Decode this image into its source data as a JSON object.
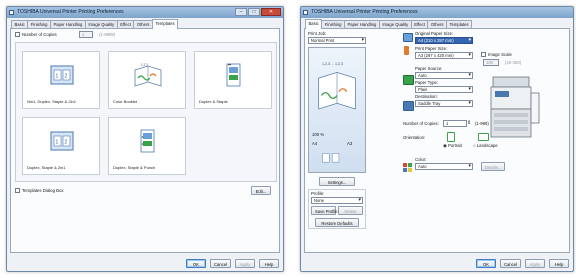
{
  "left_window": {
    "title": "TOSHIBA Universal Printer Printing Preferences",
    "tabs": [
      "Basic",
      "Finishing",
      "Paper Handling",
      "Image Quality",
      "Effect",
      "Others",
      "Templates"
    ],
    "active_tab": "Templates",
    "number_of_copies_label": "Number of Copies",
    "copies_value": "1",
    "copies_range": "(1-9999)",
    "templates": [
      {
        "caption": "Nin1, Duplex, Staple & 2in1"
      },
      {
        "caption": "Color Booklet"
      },
      {
        "caption": "Duplex & Staple"
      },
      {
        "caption": "Duplex, Staple & 2in1"
      },
      {
        "caption": "Duplex, Staple & Punch"
      }
    ],
    "templates_dialog_label": "Templates Dialog Box",
    "edit_button": "Edit...",
    "buttons": {
      "ok": "OK",
      "cancel": "Cancel",
      "apply": "Apply",
      "help": "Help"
    }
  },
  "right_window": {
    "title": "TOSHIBA Universal Printer Printing Preferences",
    "tabs": [
      "Basic",
      "Finishing",
      "Paper Handling",
      "Image Quality",
      "Effect",
      "Others",
      "Templates"
    ],
    "active_tab": "Basic",
    "print_job_label": "Print Job:",
    "print_job_value": "Normal Print",
    "preview": {
      "zoom": "100 %",
      "paper_a": "A4",
      "paper_b": "A3",
      "sample_text": "1,2,3 ... 1,2,3"
    },
    "settings_button": "Settings...",
    "profile_label": "Profile:",
    "profile_value": "None",
    "save_profile_button": "Save Profile",
    "delete_button": "Delete",
    "restore_defaults_button": "Restore Defaults",
    "original_paper_size_label": "Original Paper Size:",
    "original_paper_size_value": "A4 (210 x 297 mm)",
    "print_paper_size_label": "Print Paper Size:",
    "print_paper_size_value": "A3 (297 x 420 mm)",
    "image_scale_label": "Image Scale",
    "image_scale_value": "100",
    "image_scale_range": "(25-400)",
    "paper_source_label": "Paper Source:",
    "paper_source_value": "Auto",
    "paper_type_label": "Paper Type:",
    "paper_type_value": "Plain",
    "destination_label": "Destination:",
    "destination_value": "Saddle Tray",
    "number_of_copies_label": "Number of Copies:",
    "copies_value": "1",
    "copies_range": "(1-999)",
    "orientation_label": "Orientation:",
    "portrait_label": "Portrait",
    "landscape_label": "Landscape",
    "color_label": "Color:",
    "color_value": "Auto",
    "details_button": "Details...",
    "buttons": {
      "ok": "OK",
      "cancel": "Cancel",
      "apply": "Apply",
      "help": "Help"
    }
  },
  "colors": {
    "titlebar": "#8fb1d8",
    "close": "#c74a3a",
    "selection": "#3465b0",
    "accent_green": "#3aa34a"
  }
}
